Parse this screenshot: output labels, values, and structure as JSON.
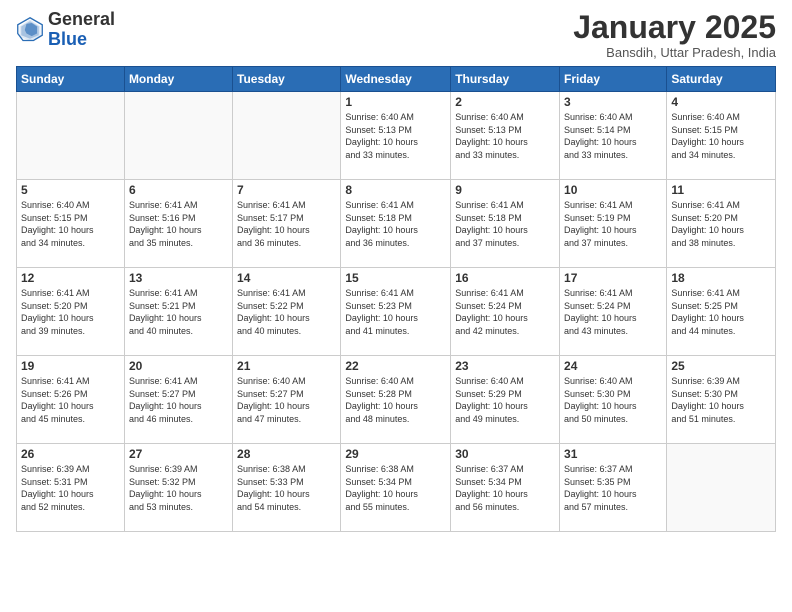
{
  "header": {
    "logo_general": "General",
    "logo_blue": "Blue",
    "month_title": "January 2025",
    "location": "Bansdih, Uttar Pradesh, India"
  },
  "weekdays": [
    "Sunday",
    "Monday",
    "Tuesday",
    "Wednesday",
    "Thursday",
    "Friday",
    "Saturday"
  ],
  "weeks": [
    [
      {
        "day": "",
        "info": ""
      },
      {
        "day": "",
        "info": ""
      },
      {
        "day": "",
        "info": ""
      },
      {
        "day": "1",
        "info": "Sunrise: 6:40 AM\nSunset: 5:13 PM\nDaylight: 10 hours\nand 33 minutes."
      },
      {
        "day": "2",
        "info": "Sunrise: 6:40 AM\nSunset: 5:13 PM\nDaylight: 10 hours\nand 33 minutes."
      },
      {
        "day": "3",
        "info": "Sunrise: 6:40 AM\nSunset: 5:14 PM\nDaylight: 10 hours\nand 33 minutes."
      },
      {
        "day": "4",
        "info": "Sunrise: 6:40 AM\nSunset: 5:15 PM\nDaylight: 10 hours\nand 34 minutes."
      }
    ],
    [
      {
        "day": "5",
        "info": "Sunrise: 6:40 AM\nSunset: 5:15 PM\nDaylight: 10 hours\nand 34 minutes."
      },
      {
        "day": "6",
        "info": "Sunrise: 6:41 AM\nSunset: 5:16 PM\nDaylight: 10 hours\nand 35 minutes."
      },
      {
        "day": "7",
        "info": "Sunrise: 6:41 AM\nSunset: 5:17 PM\nDaylight: 10 hours\nand 36 minutes."
      },
      {
        "day": "8",
        "info": "Sunrise: 6:41 AM\nSunset: 5:18 PM\nDaylight: 10 hours\nand 36 minutes."
      },
      {
        "day": "9",
        "info": "Sunrise: 6:41 AM\nSunset: 5:18 PM\nDaylight: 10 hours\nand 37 minutes."
      },
      {
        "day": "10",
        "info": "Sunrise: 6:41 AM\nSunset: 5:19 PM\nDaylight: 10 hours\nand 37 minutes."
      },
      {
        "day": "11",
        "info": "Sunrise: 6:41 AM\nSunset: 5:20 PM\nDaylight: 10 hours\nand 38 minutes."
      }
    ],
    [
      {
        "day": "12",
        "info": "Sunrise: 6:41 AM\nSunset: 5:20 PM\nDaylight: 10 hours\nand 39 minutes."
      },
      {
        "day": "13",
        "info": "Sunrise: 6:41 AM\nSunset: 5:21 PM\nDaylight: 10 hours\nand 40 minutes."
      },
      {
        "day": "14",
        "info": "Sunrise: 6:41 AM\nSunset: 5:22 PM\nDaylight: 10 hours\nand 40 minutes."
      },
      {
        "day": "15",
        "info": "Sunrise: 6:41 AM\nSunset: 5:23 PM\nDaylight: 10 hours\nand 41 minutes."
      },
      {
        "day": "16",
        "info": "Sunrise: 6:41 AM\nSunset: 5:24 PM\nDaylight: 10 hours\nand 42 minutes."
      },
      {
        "day": "17",
        "info": "Sunrise: 6:41 AM\nSunset: 5:24 PM\nDaylight: 10 hours\nand 43 minutes."
      },
      {
        "day": "18",
        "info": "Sunrise: 6:41 AM\nSunset: 5:25 PM\nDaylight: 10 hours\nand 44 minutes."
      }
    ],
    [
      {
        "day": "19",
        "info": "Sunrise: 6:41 AM\nSunset: 5:26 PM\nDaylight: 10 hours\nand 45 minutes."
      },
      {
        "day": "20",
        "info": "Sunrise: 6:41 AM\nSunset: 5:27 PM\nDaylight: 10 hours\nand 46 minutes."
      },
      {
        "day": "21",
        "info": "Sunrise: 6:40 AM\nSunset: 5:27 PM\nDaylight: 10 hours\nand 47 minutes."
      },
      {
        "day": "22",
        "info": "Sunrise: 6:40 AM\nSunset: 5:28 PM\nDaylight: 10 hours\nand 48 minutes."
      },
      {
        "day": "23",
        "info": "Sunrise: 6:40 AM\nSunset: 5:29 PM\nDaylight: 10 hours\nand 49 minutes."
      },
      {
        "day": "24",
        "info": "Sunrise: 6:40 AM\nSunset: 5:30 PM\nDaylight: 10 hours\nand 50 minutes."
      },
      {
        "day": "25",
        "info": "Sunrise: 6:39 AM\nSunset: 5:30 PM\nDaylight: 10 hours\nand 51 minutes."
      }
    ],
    [
      {
        "day": "26",
        "info": "Sunrise: 6:39 AM\nSunset: 5:31 PM\nDaylight: 10 hours\nand 52 minutes."
      },
      {
        "day": "27",
        "info": "Sunrise: 6:39 AM\nSunset: 5:32 PM\nDaylight: 10 hours\nand 53 minutes."
      },
      {
        "day": "28",
        "info": "Sunrise: 6:38 AM\nSunset: 5:33 PM\nDaylight: 10 hours\nand 54 minutes."
      },
      {
        "day": "29",
        "info": "Sunrise: 6:38 AM\nSunset: 5:34 PM\nDaylight: 10 hours\nand 55 minutes."
      },
      {
        "day": "30",
        "info": "Sunrise: 6:37 AM\nSunset: 5:34 PM\nDaylight: 10 hours\nand 56 minutes."
      },
      {
        "day": "31",
        "info": "Sunrise: 6:37 AM\nSunset: 5:35 PM\nDaylight: 10 hours\nand 57 minutes."
      },
      {
        "day": "",
        "info": ""
      }
    ]
  ]
}
